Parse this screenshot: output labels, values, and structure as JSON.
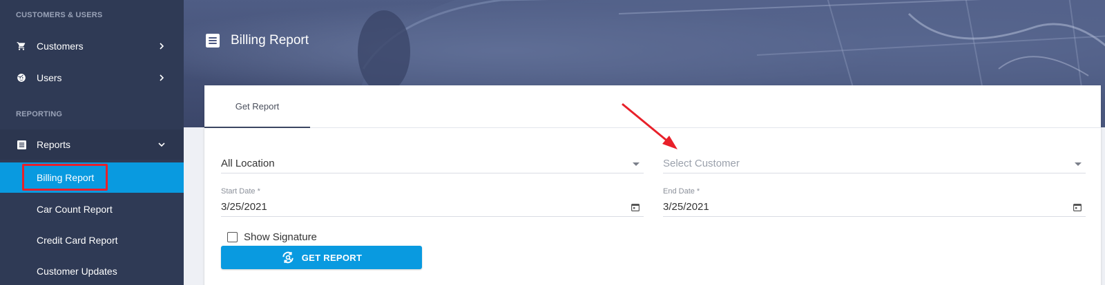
{
  "sidebar": {
    "section_customers": "CUSTOMERS & USERS",
    "section_reporting": "REPORTING",
    "items": [
      {
        "label": "Customers",
        "icon": "cart-icon"
      },
      {
        "label": "Users",
        "icon": "face-icon"
      }
    ],
    "reports": {
      "label": "Reports",
      "icon": "list-icon"
    },
    "sub_items": [
      {
        "label": "Billing Report",
        "active": true
      },
      {
        "label": "Car Count Report"
      },
      {
        "label": "Credit Card Report"
      },
      {
        "label": "Customer Updates"
      }
    ]
  },
  "header": {
    "title": "Billing Report",
    "icon": "list-icon"
  },
  "tabs": [
    {
      "label": "Get Report"
    }
  ],
  "form": {
    "location": {
      "value": "All Location"
    },
    "customer": {
      "placeholder": "Select Customer"
    },
    "start_date": {
      "label": "Start Date *",
      "value": "3/25/2021"
    },
    "end_date": {
      "label": "End Date *",
      "value": "3/25/2021"
    },
    "show_signature": {
      "label": "Show Signature",
      "checked": false
    },
    "get_report_label": "GET REPORT"
  },
  "colors": {
    "sidebar": "#2f3a55",
    "accent": "#099ae0",
    "annotation": "#e8202a"
  }
}
